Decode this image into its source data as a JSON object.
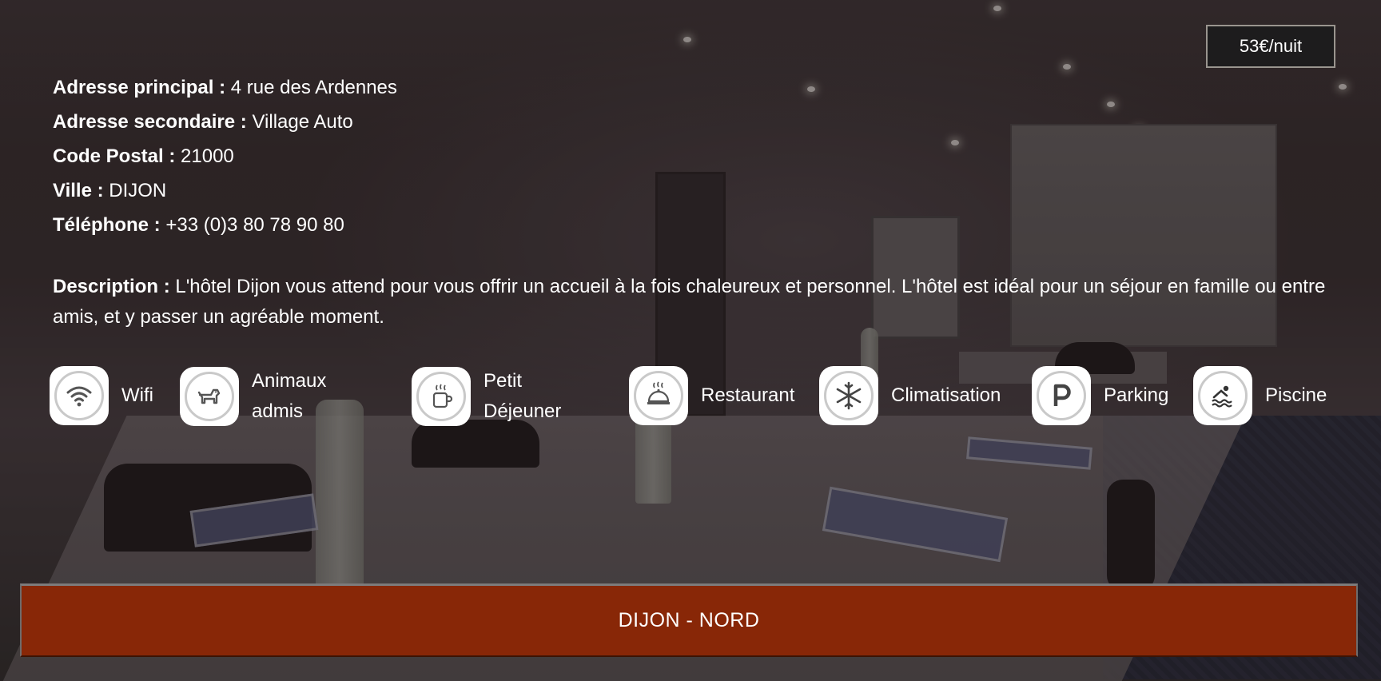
{
  "price": "53€/nuit",
  "info": [
    {
      "label": "Adresse principal :",
      "value": "4 rue des Ardennes"
    },
    {
      "label": "Adresse secondaire :",
      "value": "Village Auto"
    },
    {
      "label": "Code Postal :",
      "value": "21000"
    },
    {
      "label": "Ville :",
      "value": "DIJON"
    },
    {
      "label": "Téléphone :",
      "value": "+33 (0)3 80 78 90 80"
    }
  ],
  "description": {
    "label": "Description :",
    "text": "L'hôtel Dijon vous attend pour vous offrir un accueil à la fois chaleureux et personnel. L'hôtel est idéal pour un séjour en famille ou entre amis, et y passer un agréable moment."
  },
  "amenities": [
    {
      "icon": "wifi-icon",
      "line1": "Wifi",
      "line2": ""
    },
    {
      "icon": "dog-icon",
      "line1": "Animaux",
      "line2": "admis"
    },
    {
      "icon": "coffee-cup-icon",
      "line1": "Petit",
      "line2": "Déjeuner"
    },
    {
      "icon": "cloche-icon",
      "line1": "Restaurant",
      "line2": ""
    },
    {
      "icon": "snowflake-icon",
      "line1": "Climatisation",
      "line2": ""
    },
    {
      "icon": "parking-icon",
      "line1": "Parking",
      "line2": ""
    },
    {
      "icon": "swimmer-icon",
      "line1": "Piscine",
      "line2": ""
    }
  ],
  "footer": {
    "title": "DIJON - NORD"
  },
  "colors": {
    "bar": "#882707",
    "text": "#ffffff",
    "price_bg": "#1d1c1d"
  }
}
